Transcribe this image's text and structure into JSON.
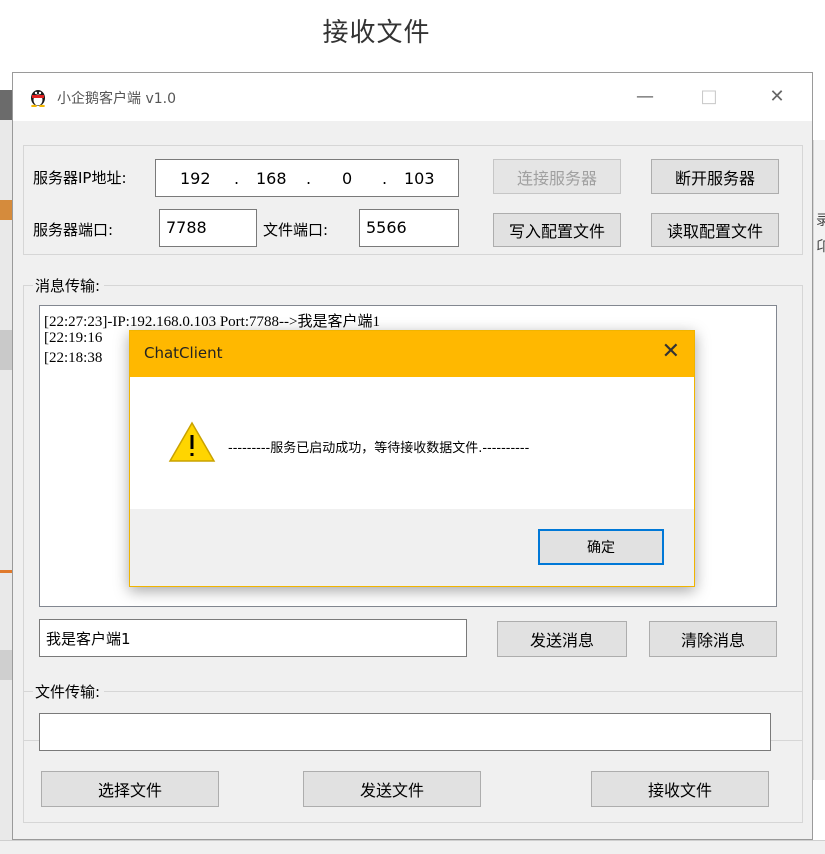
{
  "heading": "接收文件",
  "window": {
    "title": "小企鹅客户端 v1.0",
    "minimize": "—",
    "maximize": "□",
    "close": "✕"
  },
  "server": {
    "ip_label": "服务器IP地址:",
    "ip_parts": [
      "192",
      "168",
      "0",
      "103"
    ],
    "port_label": "服务器端口:",
    "port_value": "7788",
    "file_port_label": "文件端口:",
    "file_port_value": "5566",
    "connect_button": "连接服务器",
    "disconnect_button": "断开服务器",
    "write_config_button": "写入配置文件",
    "read_config_button": "读取配置文件"
  },
  "messages": {
    "group_label": "消息传输:",
    "log": [
      "[22:27:23]-IP:192.168.0.103 Port:7788-->我是客户端1",
      "[22:19:16",
      "[22:18:38"
    ],
    "input_value": "我是客户端1",
    "send_button": "发送消息",
    "clear_button": "清除消息"
  },
  "files": {
    "group_label": "文件传输:",
    "path_value": "",
    "select_button": "选择文件",
    "send_button": "发送文件",
    "receive_button": "接收文件"
  },
  "dialog": {
    "title": "ChatClient",
    "close": "✕",
    "message": "---------服务已启动成功，等待接收数据文件.----------",
    "ok_button": "确定"
  },
  "background": {
    "right_glyphs": [
      "录",
      "卬"
    ]
  },
  "colors": {
    "dialog_titlebar": "#ffb800",
    "ok_button_border": "#0078d7",
    "window_client": "#f0f0f0"
  },
  "icons": {
    "app": "penguin-icon",
    "dialog": "warning-icon"
  }
}
